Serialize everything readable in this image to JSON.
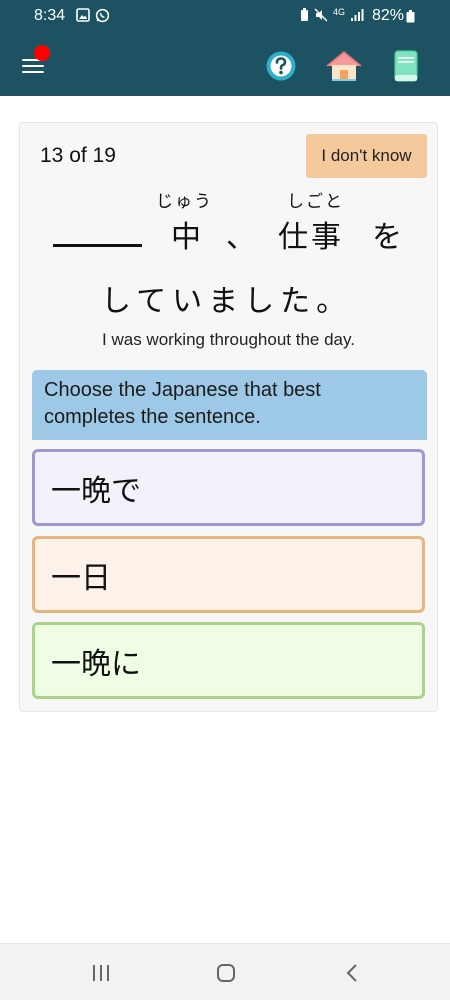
{
  "status_bar": {
    "time": "8:34",
    "network": "4G",
    "battery": "82%"
  },
  "header": {
    "menu_icon": "hamburger-menu-icon",
    "help_icon": "question-icon",
    "home_icon": "home-icon",
    "book_icon": "book-icon",
    "badge_color": "#ff0000"
  },
  "quiz": {
    "progress": "13 of 19",
    "dont_know_label": "I don't know",
    "sentence": {
      "row1": {
        "ju_ruby": "じゅう",
        "ju_kanji": "中",
        "comma": "、",
        "shigoto_ruby": "しごと",
        "shigoto_kanji": "仕事",
        "particle": "を"
      },
      "row2": "していました。"
    },
    "translation": "I was working throughout the day.",
    "instruction": "Choose the Japanese that best completes the sentence.",
    "options": [
      {
        "label": "一晩で"
      },
      {
        "label": "一日"
      },
      {
        "label": "一晩に"
      }
    ]
  },
  "colors": {
    "header_bg": "#1d5263",
    "dont_know_bg": "#f4c99c",
    "instruction_bg": "#9dc9e6"
  }
}
